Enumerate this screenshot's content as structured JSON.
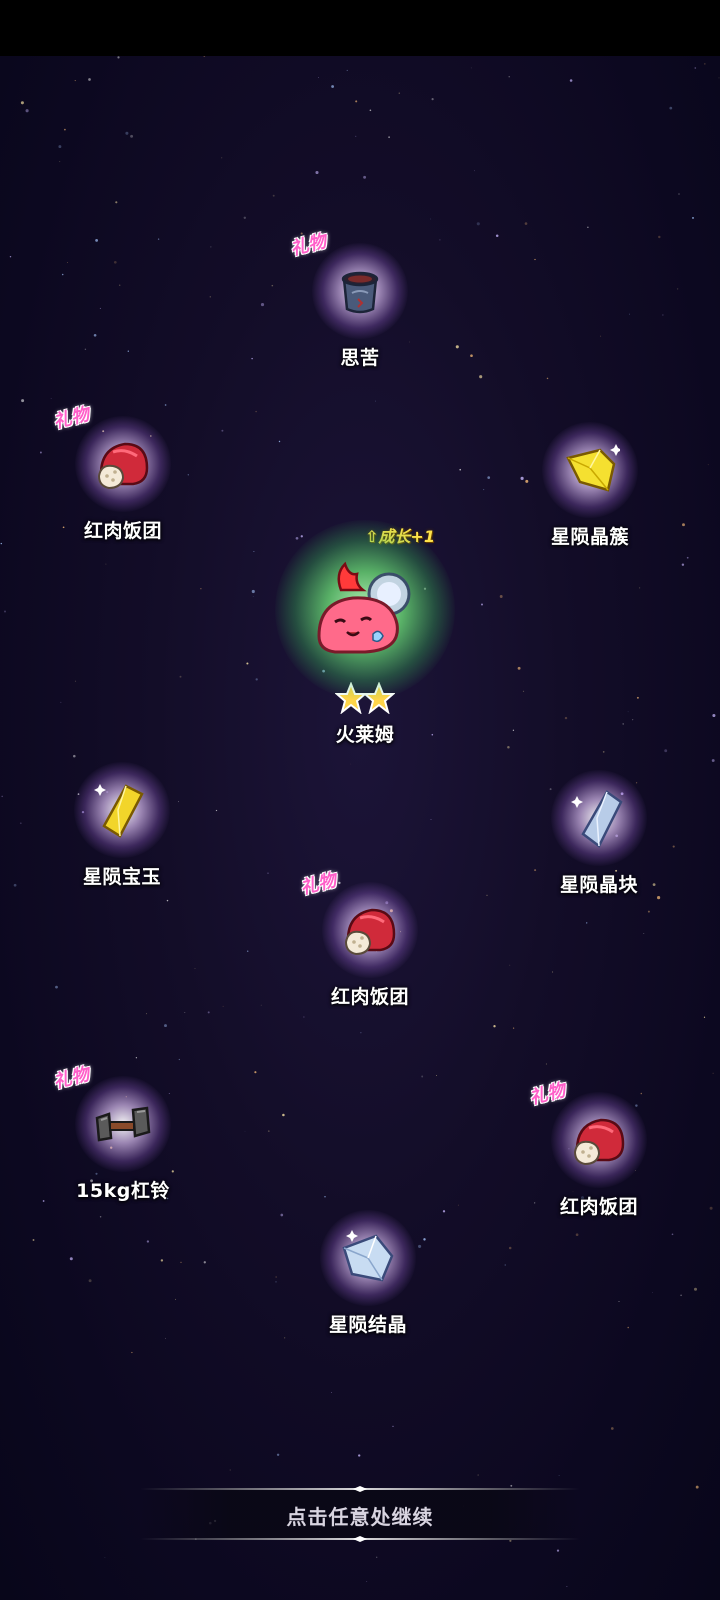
{
  "hero": {
    "name": "火莱姆",
    "growth_tag": "成长+1",
    "star_count": 2,
    "icon": "fire-slime-character",
    "glow_color": "#6ee07a"
  },
  "items": [
    {
      "label": "思苦",
      "gift_tag": "礼物",
      "icon": "sleep-pot-icon"
    },
    {
      "label": "红肉饭团",
      "gift_tag": "礼物",
      "icon": "red-meat-rice-ball-icon"
    },
    {
      "label": "星陨晶簇",
      "gift_tag": "",
      "icon": "yellow-star-crystal-cluster-icon"
    },
    {
      "label": "星陨宝玉",
      "gift_tag": "",
      "icon": "yellow-gem-icon"
    },
    {
      "label": "星陨晶块",
      "gift_tag": "",
      "icon": "blue-crystal-chunk-icon"
    },
    {
      "label": "红肉饭团",
      "gift_tag": "礼物",
      "icon": "red-meat-rice-ball-icon"
    },
    {
      "label": "15kg杠铃",
      "gift_tag": "礼物",
      "icon": "dumbbell-icon"
    },
    {
      "label": "红肉饭团",
      "gift_tag": "礼物",
      "icon": "red-meat-rice-ball-icon"
    },
    {
      "label": "星陨结晶",
      "gift_tag": "",
      "icon": "blue-star-crystal-icon"
    }
  ],
  "footer": {
    "continue_text": "点击任意处继续"
  },
  "colors": {
    "background": "#100b24",
    "gift_tag": "#ff5fc9",
    "growth_tag": "#ffe24a",
    "label": "#ffffff"
  }
}
